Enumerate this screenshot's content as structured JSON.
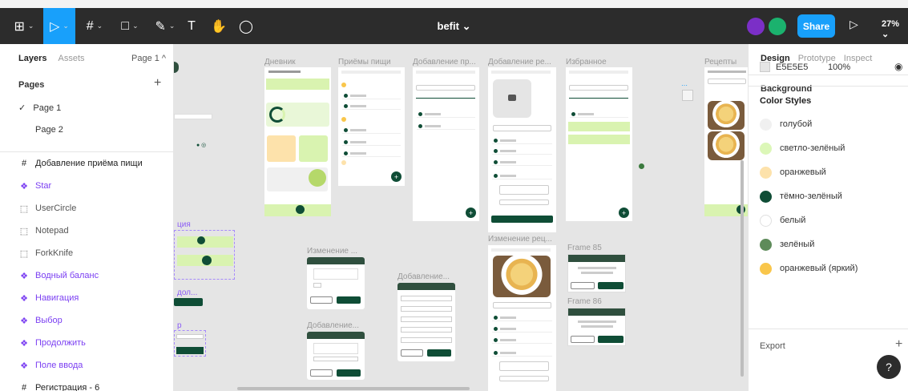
{
  "app": {
    "file_title": "befit",
    "share_label": "Share",
    "zoom": "27%",
    "tools": [
      "figma-menu",
      "move",
      "frame",
      "shape",
      "pen",
      "text",
      "hand",
      "comment"
    ]
  },
  "left_panel": {
    "tabs": [
      "Layers",
      "Assets"
    ],
    "page_selector": "Page 1 ^",
    "pages_title": "Pages",
    "pages": [
      "Page 1",
      "Page 2"
    ],
    "layers": [
      {
        "kind": "frame",
        "icon": "#",
        "label": "Добавление приёма пищи"
      },
      {
        "kind": "component",
        "icon": "❖",
        "label": "Star"
      },
      {
        "kind": "group",
        "icon": "⬚",
        "label": "UserCircle"
      },
      {
        "kind": "group",
        "icon": "⬚",
        "label": "Notepad"
      },
      {
        "kind": "group",
        "icon": "⬚",
        "label": "ForkKnife"
      },
      {
        "kind": "component",
        "icon": "❖",
        "label": "Водный баланс"
      },
      {
        "kind": "component",
        "icon": "❖",
        "label": "Навигация"
      },
      {
        "kind": "component",
        "icon": "❖",
        "label": "Выбор"
      },
      {
        "kind": "component",
        "icon": "❖",
        "label": "Продолжить"
      },
      {
        "kind": "component",
        "icon": "❖",
        "label": "Поле ввода"
      },
      {
        "kind": "frame",
        "icon": "#",
        "label": "Регистрация - 6"
      }
    ]
  },
  "canvas": {
    "frame_labels": {
      "diary": "Дневник",
      "meals": "Приёмы пищи",
      "add_breakfast": "Добавление пр...",
      "add_recipe": "Добавление ре...",
      "favorites": "Избранное",
      "recipes": "Рецепты",
      "change1": "Изменение ...",
      "add_product": "Добавление...",
      "change2": "Добавление...",
      "change_recipe": "Изменение рец...",
      "frame85": "Frame 85",
      "frame86": "Frame 86",
      "partial_a": "ция",
      "partial_b": "дол...",
      "partial_c": "р"
    }
  },
  "right_panel": {
    "tabs": [
      "Design",
      "Prototype",
      "Inspect"
    ],
    "background_title": "Background",
    "background_hex": "E5E5E5",
    "background_opacity": "100%",
    "color_styles_title": "Color Styles",
    "color_styles": [
      {
        "name": "голубой",
        "color": "#f0f0f0"
      },
      {
        "name": "светло-зелёный",
        "color": "#dcf7b8"
      },
      {
        "name": "оранжевый",
        "color": "#fde2ab"
      },
      {
        "name": "тёмно-зелёный",
        "color": "#0f4d36"
      },
      {
        "name": "белый",
        "color": "#ffffff"
      },
      {
        "name": "зелёный",
        "color": "#5e8b5a"
      },
      {
        "name": "оранжевый (яркий)",
        "color": "#f9c64b"
      }
    ],
    "export_title": "Export"
  }
}
